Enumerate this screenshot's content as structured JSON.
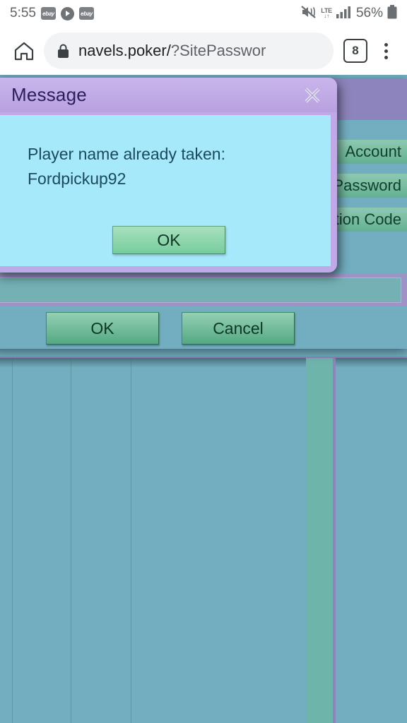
{
  "status_bar": {
    "clock": "5:55",
    "app_icons": [
      {
        "name": "ebay-icon",
        "label": "ebay"
      },
      {
        "name": "media-play-icon",
        "label": ""
      },
      {
        "name": "ebay-icon",
        "label": "ebay"
      }
    ],
    "mute_icon": "mute-icon",
    "network_type": "LTE",
    "network_arrows": "↓↑",
    "signal_icon": "signal-bars-icon",
    "battery_percent": "56%",
    "battery_icon": "battery-icon"
  },
  "browser": {
    "home_icon": "home-icon",
    "lock_icon": "lock-icon",
    "url_visible": "navels.poker/?SitePasswor",
    "url_domain": "navels.poker/",
    "url_query": "?SitePasswor",
    "tab_count": "8",
    "menu_icon": "overflow-menu-icon"
  },
  "register_dialog": {
    "fields": [
      {
        "label": "Account"
      },
      {
        "label": "Password"
      },
      {
        "label": "Confirmation Code"
      }
    ],
    "ok_label": "OK",
    "cancel_label": "Cancel"
  },
  "message_dialog": {
    "title": "Message",
    "close_icon": "close-icon",
    "line1": "Player name already taken:",
    "line2": "Fordpickup92",
    "ok_label": "OK"
  },
  "colors": {
    "page_background": "#72aec0",
    "dialog_header": "#c0a9e6",
    "dialog_body": "#a6e9fb",
    "button_green": "#77cc9c",
    "accent_purple": "#8e84bd",
    "field_green": "#63b092",
    "text_dark_teal": "#1a4a5c"
  }
}
